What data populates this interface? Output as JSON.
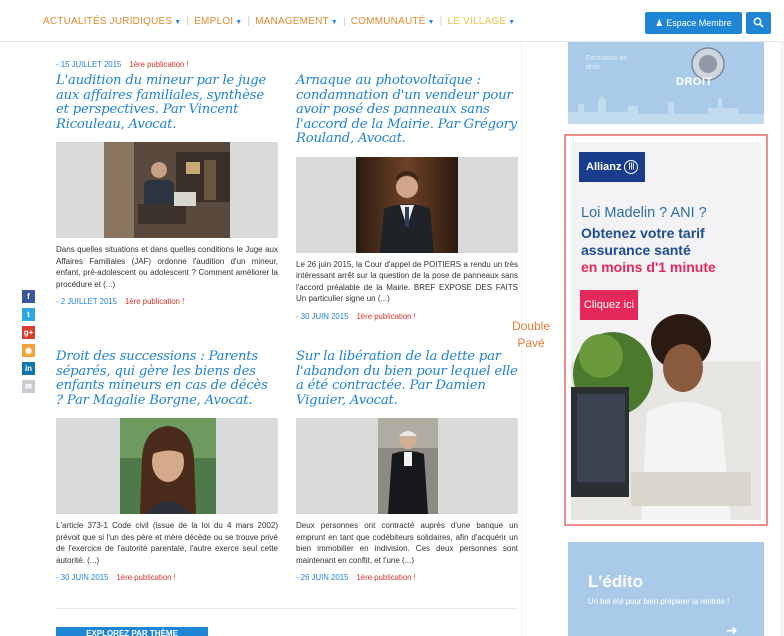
{
  "nav": {
    "items": [
      {
        "label": "ACTUALITÉS JURIDIQUES",
        "color": "#e08a2e"
      },
      {
        "label": "EMPLOI",
        "color": "#e08a2e"
      },
      {
        "label": "MANAGEMENT",
        "color": "#e08a2e"
      },
      {
        "label": "COMMUNAUTÉ",
        "color": "#e08a2e"
      },
      {
        "label": "LE VILLAGE",
        "color": "#e8c34a"
      }
    ],
    "member_button": "Espace Membre"
  },
  "top_meta": {
    "date": "- 15 JUILLET 2015",
    "first": "1ère publication !"
  },
  "articles": [
    {
      "title": "L'audition du mineur par le juge aux affaires familiales, synthèse et perspectives. Par Vincent Ricouleau, Avocat.",
      "excerpt": "Dans quelles situations et dans quelles conditions le Juge aux Affaires Familiales (JAF) ordonne l'audition d'un mineur, enfant, pré-adolescent ou adolescent ? Comment améliorer la procédure et (...)",
      "date": "- 2 JUILLET 2015",
      "first": "1ère publication !"
    },
    {
      "title": "Arnaque au photovoltaïque : condamnation d'un vendeur pour avoir posé des panneaux sans l'accord de la Mairie. Par Grégory Rouland, Avocat.",
      "excerpt": "Le 26 juin 2015, la Cour d'appel de POITIERS a rendu un très intéressant arrêt sur la question de la pose de panneaux sans l'accord préalable de la Mairie. BREF EXPOSE DES FAITS Un particulier signe un (...)",
      "date": "- 30 JUIN 2015",
      "first": "1ère publication !"
    },
    {
      "title": "Droit des successions : Parents séparés, qui gère les biens des enfants mineurs en cas de décès ? Par Magalie Borgne, Avocat.",
      "excerpt": "L'article 373-1 Code civil (issue de la loi du 4 mars 2002) prévoit que si l'un des père et mère décède ou se trouve privé de l'exercice de l'autorité parentale, l'autre exerce seul cette autorité. (...)",
      "date": "- 30 JUIN 2015",
      "first": "1ère publication !"
    },
    {
      "title": "Sur la libération de la dette par l'abandon du bien pour lequel elle a été contractée. Par Damien Viguier, Avocat.",
      "excerpt": "Deux personnes ont contracté auprès d'une banque un emprunt en tant que codébiteurs solidaires, afin d'acquérir un bien immobilier en indivision. Ces deux personnes sont maintenant en conflit, et l'une (...)",
      "date": "- 26 JUIN 2015",
      "first": "1ère publication !"
    }
  ],
  "explore_button": "EXPLOREZ PAR THÈME",
  "promo_top": {
    "lines": [
      "Formation en",
      "droit"
    ],
    "brand": "DROIT"
  },
  "ad": {
    "brand": "Allianz",
    "line1": "Loi Madelin ? ANI ?",
    "line2a": "Obtenez votre tarif",
    "line2b": "assurance santé",
    "line3": "en moins d'1 minute",
    "cta": "Cliquez ici"
  },
  "ad_label": {
    "line1": "Double",
    "line2": "Pavé"
  },
  "edito": {
    "title": "L'édito",
    "subtitle": "Un bel été pour bien préparer la rentrée !"
  },
  "colors": {
    "accent_blue": "#1f82cf",
    "orange": "#e08a2e",
    "red": "#d9352b",
    "allianz_pink": "#e5285a"
  }
}
